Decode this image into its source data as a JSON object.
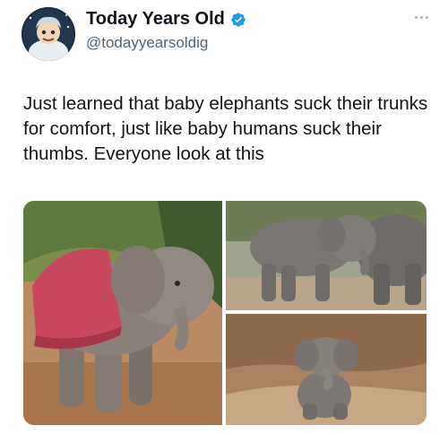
{
  "header": {
    "display_name": "Today Years Old",
    "handle": "@todayyearsoldig",
    "avatar_icon": "avatar-image",
    "verified_icon": "verified-badge-icon",
    "more_icon": "more-options-icon"
  },
  "tweet": {
    "text": "Just learned that baby elephants suck their trunks for comfort, just like baby humans suck their thumbs. Everyone look at this"
  },
  "media": {
    "photos": [
      {
        "subject": "baby elephant in red blanket sucking trunk"
      },
      {
        "subject": "baby elephant with adult elephant"
      },
      {
        "subject": "baby elephant sitting with trunk in mouth"
      }
    ]
  },
  "colors": {
    "text": "#0f1419",
    "secondary_text": "#536471",
    "verified_blue": "#1d9bf0"
  }
}
